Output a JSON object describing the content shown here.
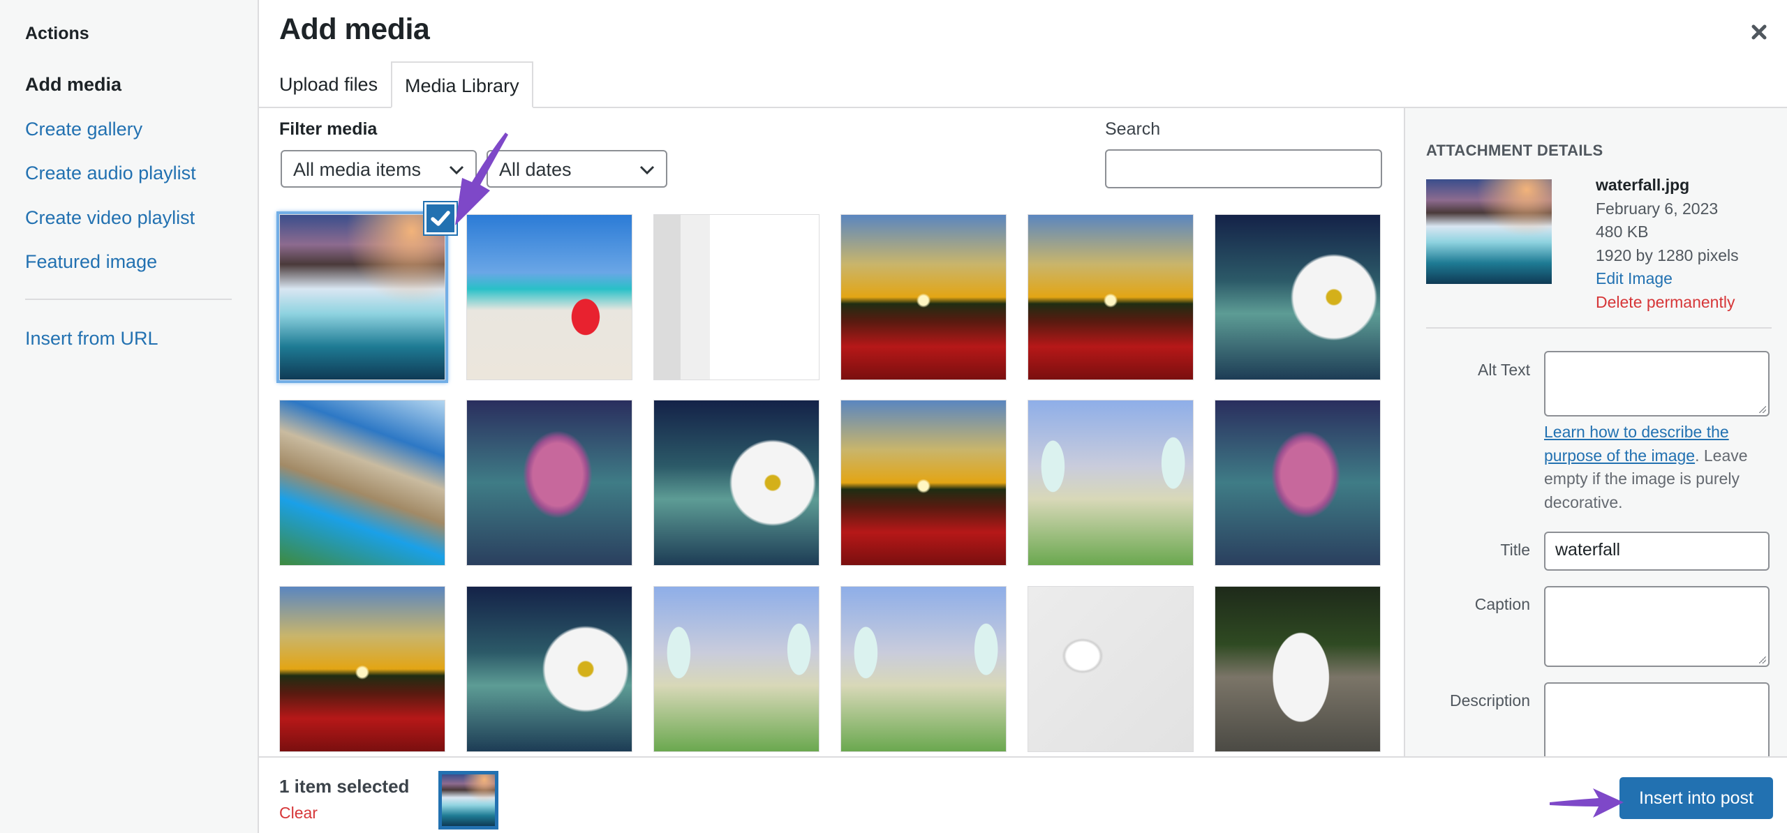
{
  "sidebar": {
    "heading": "Actions",
    "items": [
      {
        "label": "Add media",
        "active": true
      },
      {
        "label": "Create gallery"
      },
      {
        "label": "Create audio playlist"
      },
      {
        "label": "Create video playlist"
      },
      {
        "label": "Featured image"
      },
      {
        "label": "Insert from URL"
      }
    ]
  },
  "modal": {
    "title": "Add media",
    "close_icon": "close-icon",
    "tabs": [
      {
        "label": "Upload files",
        "active": false
      },
      {
        "label": "Media Library",
        "active": true
      }
    ]
  },
  "filters": {
    "label": "Filter media",
    "type_select": "All media items",
    "date_select": "All dates",
    "search_label": "Search",
    "search_value": ""
  },
  "grid": {
    "items": [
      {
        "subject": "waterfall",
        "selected": true
      },
      {
        "subject": "beach-drink"
      },
      {
        "subject": "screenshot-file-upload"
      },
      {
        "subject": "sunset-poppies"
      },
      {
        "subject": "sunset-poppies"
      },
      {
        "subject": "daisy"
      },
      {
        "subject": "coastal-cliff-beach"
      },
      {
        "subject": "rose"
      },
      {
        "subject": "daisy"
      },
      {
        "subject": "sunset-poppies"
      },
      {
        "subject": "butterflies"
      },
      {
        "subject": "rose"
      },
      {
        "subject": "sunset-poppies"
      },
      {
        "subject": "daisy"
      },
      {
        "subject": "butterflies"
      },
      {
        "subject": "butterflies"
      },
      {
        "subject": "airpods"
      },
      {
        "subject": "duck"
      }
    ],
    "check_icon": "checkmark-icon"
  },
  "details": {
    "heading": "ATTACHMENT DETAILS",
    "filename": "waterfall.jpg",
    "date": "February 6, 2023",
    "size": "480 KB",
    "dimensions": "1920 by 1280 pixels",
    "edit_link": "Edit Image",
    "delete_link": "Delete permanently",
    "alt_text_label": "Alt Text",
    "alt_text_value": "",
    "help_link": "Learn how to describe the purpose of the image",
    "help_text": ". Leave empty if the image is purely decorative.",
    "title_label": "Title",
    "title_value": "waterfall",
    "caption_label": "Caption",
    "caption_value": "",
    "description_label": "Description",
    "description_value": ""
  },
  "toolbar": {
    "selected_count": "1 item selected",
    "clear_label": "Clear",
    "insert_button": "Insert into post"
  },
  "colors": {
    "accent": "#2271b1",
    "danger": "#d63638",
    "annotation_arrow": "#7e48c8"
  }
}
